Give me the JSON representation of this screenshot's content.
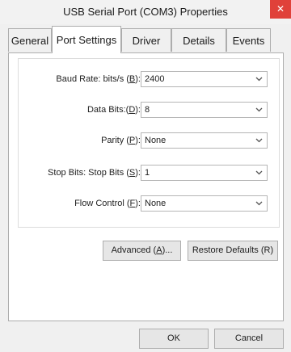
{
  "window": {
    "title": "USB Serial Port (COM3) Properties",
    "close_glyph": "✕"
  },
  "tabs": [
    {
      "label": "General"
    },
    {
      "label": "Port Settings"
    },
    {
      "label": "Driver"
    },
    {
      "label": "Details"
    },
    {
      "label": "Events"
    }
  ],
  "settings": {
    "baud_rate": {
      "label_pre": "Baud Rate: bits/s (",
      "label_key": "B",
      "label_post": "):",
      "value": "2400"
    },
    "data_bits": {
      "label_pre": "Data Bits:(",
      "label_key": "D",
      "label_post": "):",
      "value": "8"
    },
    "parity": {
      "label_pre": "Parity (",
      "label_key": "P",
      "label_post": "):",
      "value": "None"
    },
    "stop_bits": {
      "label_pre": "Stop Bits: Stop Bits (",
      "label_key": "S",
      "label_post": "):",
      "value": "1"
    },
    "flow_control": {
      "label_pre": "Flow Control (",
      "label_key": "F",
      "label_post": "):",
      "value": "None"
    }
  },
  "actions": {
    "advanced_pre": "Advanced (",
    "advanced_key": "A",
    "advanced_post": ")...",
    "restore_defaults": "Restore Defaults (R)"
  },
  "footer": {
    "ok": "OK",
    "cancel": "Cancel"
  },
  "icons": {
    "dropdown": "chevron-down-icon",
    "close": "close-icon"
  },
  "colors": {
    "close_button": "#e0413a",
    "window_bg": "#f0f0f0",
    "panel_bg": "#ffffff"
  }
}
